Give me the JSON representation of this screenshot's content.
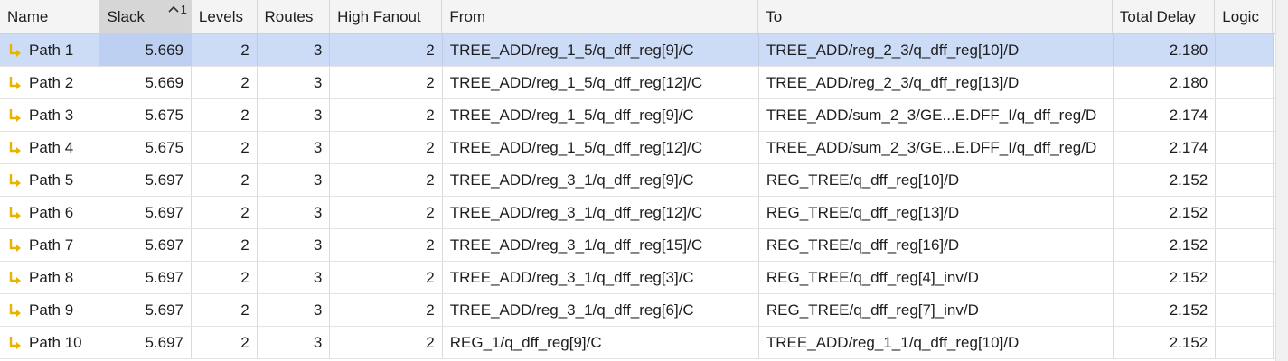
{
  "columns": {
    "name": "Name",
    "slack": "Slack",
    "levels": "Levels",
    "routes": "Routes",
    "high_fanout": "High Fanout",
    "from": "From",
    "to": "To",
    "total_delay": "Total Delay",
    "logic": "Logic"
  },
  "sort": {
    "column": "Slack",
    "direction": "ascending",
    "priority": "1",
    "icon": "caret-up-icon"
  },
  "colors": {
    "selected_row": "#cddcf6",
    "sorted_header": "#d6d6d6",
    "path_icon": "#e8b400"
  },
  "rows": [
    {
      "name": "Path 1",
      "slack": "5.669",
      "levels": "2",
      "routes": "3",
      "high_fanout": "2",
      "from": "TREE_ADD/reg_1_5/q_dff_reg[9]/C",
      "to": "TREE_ADD/reg_2_3/q_dff_reg[10]/D",
      "total_delay": "2.180",
      "logic": "",
      "selected": true
    },
    {
      "name": "Path 2",
      "slack": "5.669",
      "levels": "2",
      "routes": "3",
      "high_fanout": "2",
      "from": "TREE_ADD/reg_1_5/q_dff_reg[12]/C",
      "to": "TREE_ADD/reg_2_3/q_dff_reg[13]/D",
      "total_delay": "2.180",
      "logic": ""
    },
    {
      "name": "Path 3",
      "slack": "5.675",
      "levels": "2",
      "routes": "3",
      "high_fanout": "2",
      "from": "TREE_ADD/reg_1_5/q_dff_reg[9]/C",
      "to": "TREE_ADD/sum_2_3/GE...E.DFF_I/q_dff_reg/D",
      "total_delay": "2.174",
      "logic": ""
    },
    {
      "name": "Path 4",
      "slack": "5.675",
      "levels": "2",
      "routes": "3",
      "high_fanout": "2",
      "from": "TREE_ADD/reg_1_5/q_dff_reg[12]/C",
      "to": "TREE_ADD/sum_2_3/GE...E.DFF_I/q_dff_reg/D",
      "total_delay": "2.174",
      "logic": ""
    },
    {
      "name": "Path 5",
      "slack": "5.697",
      "levels": "2",
      "routes": "3",
      "high_fanout": "2",
      "from": "TREE_ADD/reg_3_1/q_dff_reg[9]/C",
      "to": "REG_TREE/q_dff_reg[10]/D",
      "total_delay": "2.152",
      "logic": ""
    },
    {
      "name": "Path 6",
      "slack": "5.697",
      "levels": "2",
      "routes": "3",
      "high_fanout": "2",
      "from": "TREE_ADD/reg_3_1/q_dff_reg[12]/C",
      "to": "REG_TREE/q_dff_reg[13]/D",
      "total_delay": "2.152",
      "logic": ""
    },
    {
      "name": "Path 7",
      "slack": "5.697",
      "levels": "2",
      "routes": "3",
      "high_fanout": "2",
      "from": "TREE_ADD/reg_3_1/q_dff_reg[15]/C",
      "to": "REG_TREE/q_dff_reg[16]/D",
      "total_delay": "2.152",
      "logic": ""
    },
    {
      "name": "Path 8",
      "slack": "5.697",
      "levels": "2",
      "routes": "3",
      "high_fanout": "2",
      "from": "TREE_ADD/reg_3_1/q_dff_reg[3]/C",
      "to": "REG_TREE/q_dff_reg[4]_inv/D",
      "total_delay": "2.152",
      "logic": ""
    },
    {
      "name": "Path 9",
      "slack": "5.697",
      "levels": "2",
      "routes": "3",
      "high_fanout": "2",
      "from": "TREE_ADD/reg_3_1/q_dff_reg[6]/C",
      "to": "REG_TREE/q_dff_reg[7]_inv/D",
      "total_delay": "2.152",
      "logic": ""
    },
    {
      "name": "Path 10",
      "slack": "5.697",
      "levels": "2",
      "routes": "3",
      "high_fanout": "2",
      "from": "REG_1/q_dff_reg[9]/C",
      "to": "TREE_ADD/reg_1_1/q_dff_reg[10]/D",
      "total_delay": "2.152",
      "logic": ""
    }
  ]
}
